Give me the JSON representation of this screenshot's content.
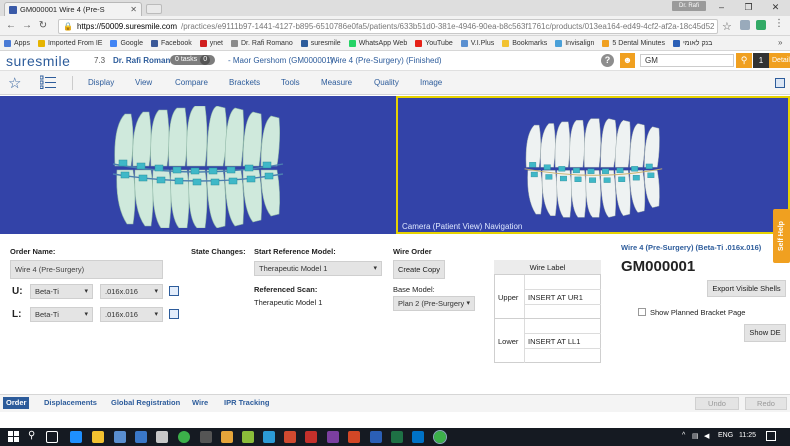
{
  "browser": {
    "tab_title": "GM000001 Wire 4 (Pre-S",
    "profile_name": "Dr. Rafi",
    "url_host": "https://50009.suresmile.com",
    "url_path": "/practices/e9111b97-1441-4127-b895-6510786e0fa5/patients/633b51d0-381e-4946-90ea-b8c563f1761c/products/013ea164-ed49-4cf2-af2a-18c45d52",
    "bookmarks": [
      "Apps",
      "Imported From IE",
      "Google",
      "Facebook",
      "ynet",
      "Dr. Rafi Romano",
      "suresmile",
      "WhatsApp Web",
      "YouTube",
      "V.I.Plus",
      "Bookmarks",
      "Invisalign",
      "5 Dental Minutes",
      "בנק לאומי"
    ],
    "bookmark_colors": [
      "#4a7bd6",
      "#e6b400",
      "#4285f4",
      "#3b5998",
      "#d01e1e",
      "#8a8a8a",
      "#2d5c9b",
      "#25d366",
      "#e62117",
      "#5a8fd0",
      "#f2c230",
      "#4aa0d8",
      "#f0a020",
      "#2b5fb6"
    ]
  },
  "header": {
    "logo": "suresmile",
    "version": "7.3",
    "doctor": "Dr. Rafi Romano",
    "tasks_label": "0 tasks",
    "tasks_count": "0",
    "patient": "-  Maor Gershom (GM000001)  -",
    "wire_crumb": "Wire 4 (Pre-Surgery) (Finished)",
    "help": "?",
    "search_value": "GM",
    "result_count": "1",
    "details_label": "Details",
    "accent_color": "#f0a020",
    "brand_color": "#2d5c9b"
  },
  "menu": [
    "Display",
    "View",
    "Compare",
    "Brackets",
    "Tools",
    "Measure",
    "Quality",
    "Image"
  ],
  "viewer": {
    "nav_label": "Camera (Patient View) Navigation",
    "background_color": "#3343a8",
    "highlight_color": "#e6d200"
  },
  "order": {
    "order_name_label": "Order Name:",
    "order_name_value": "Wire 4 (Pre-Surgery)",
    "upper_label": "U:",
    "lower_label": "L:",
    "upper_material": "Beta-Ti",
    "upper_size": ".016x.016",
    "lower_material": "Beta-Ti",
    "lower_size": ".016x.016",
    "state_changes_label": "State Changes:",
    "start_ref_label": "Start Reference Model:",
    "start_ref_value": "Therapeutic Model 1",
    "ref_scan_label": "Referenced Scan:",
    "ref_scan_value": "Therapeutic Model 1",
    "wire_order_label": "Wire Order",
    "create_copy": "Create Copy",
    "base_model_label": "Base Model:",
    "base_model_value": "Plan 2 (Pre-Surgery)"
  },
  "wire_label": {
    "header": "Wire Label",
    "upper_label": "Upper",
    "upper_value": "INSERT AT UR1",
    "lower_label": "Lower",
    "lower_value": "INSERT AT LL1"
  },
  "info": {
    "wire_title": "Wire 4 (Pre-Surgery) (Beta-Ti .016x.016)",
    "case_id": "GM000001",
    "export_btn": "Export Visible Shells",
    "show_bracket_label": "Show Planned Bracket Page",
    "show_de_btn": "Show DE",
    "self_help": "Self Help"
  },
  "bottom_tabs": [
    "Order",
    "Displacements",
    "Global Registration",
    "Wire",
    "IPR Tracking"
  ],
  "undo": "Undo",
  "redo": "Redo",
  "taskbar": {
    "lang": "ENG",
    "time": "11:25"
  }
}
